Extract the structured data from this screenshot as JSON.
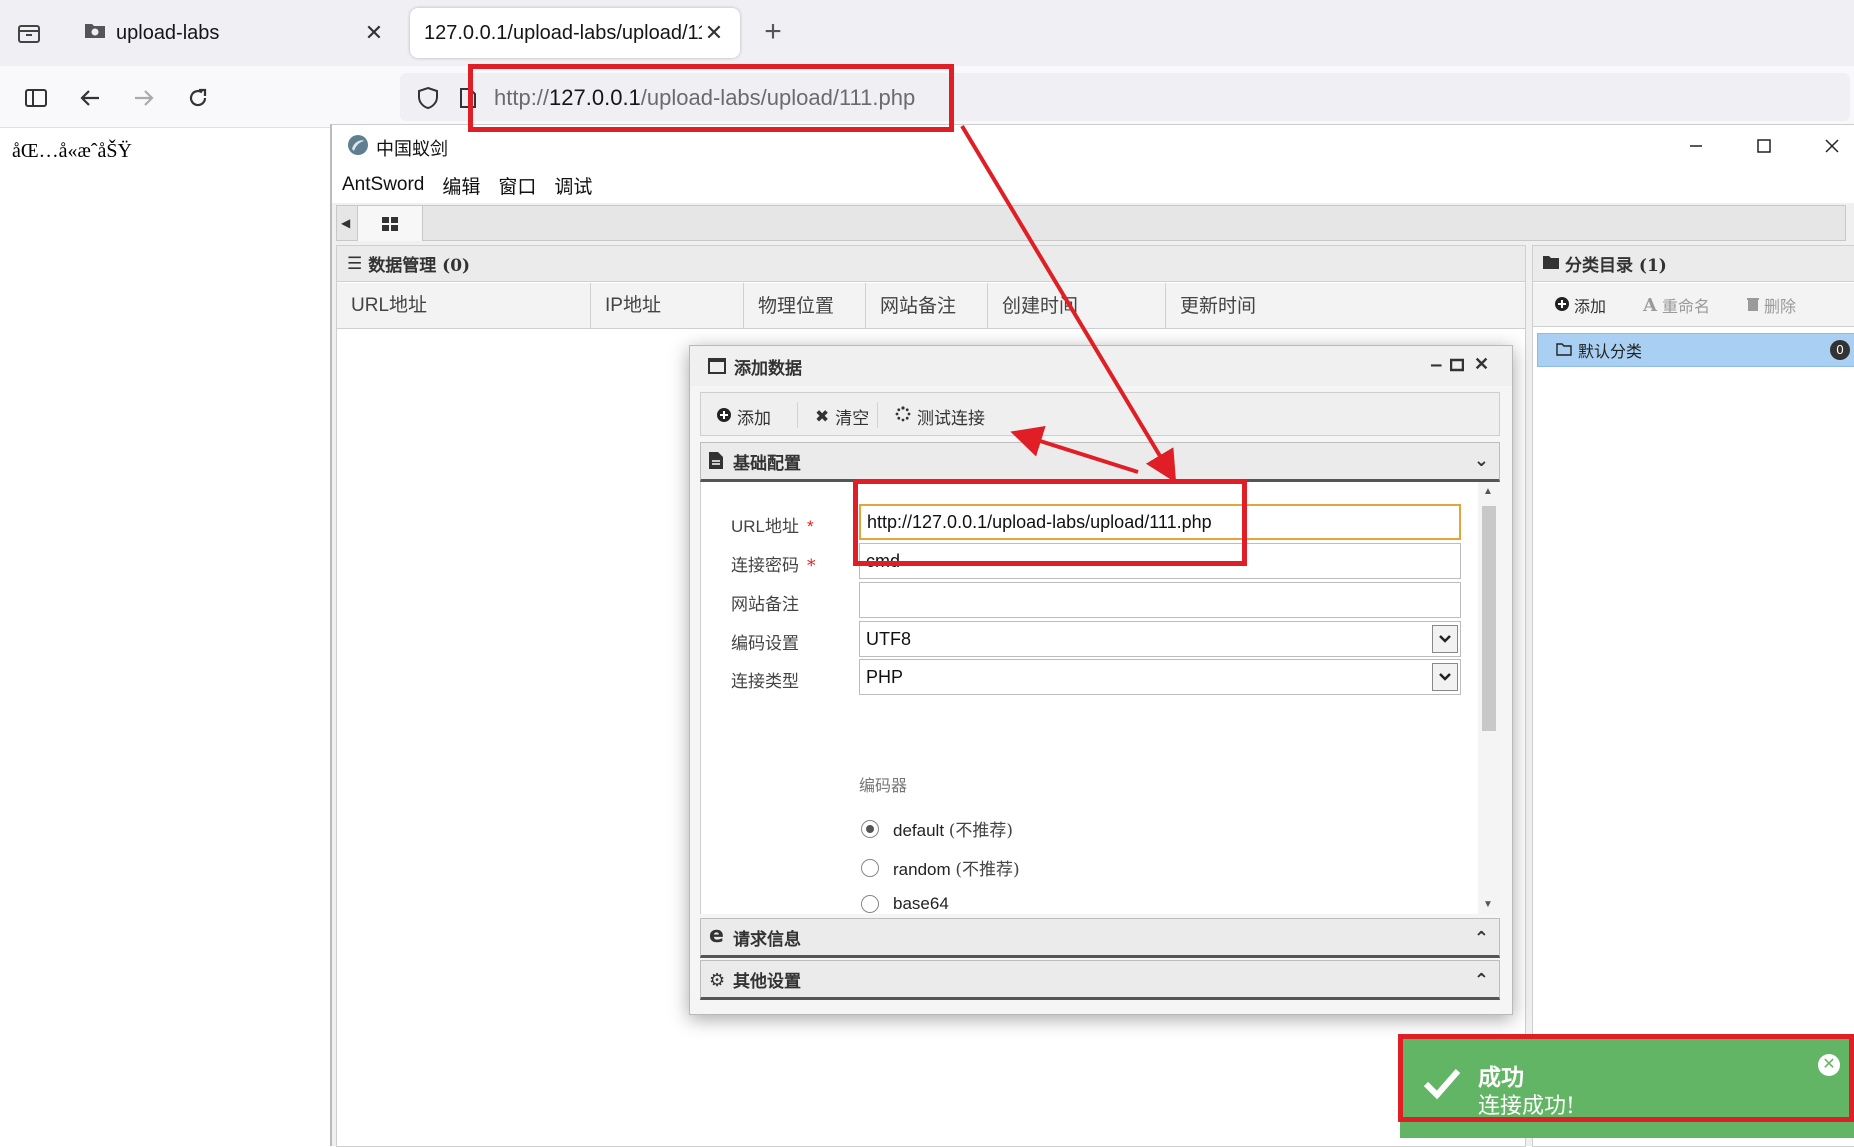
{
  "browser": {
    "tabs": [
      {
        "label": "upload-labs",
        "close": "✕"
      },
      {
        "label": "127.0.0.1/upload-labs/upload/11",
        "close": "✕"
      }
    ],
    "new_tab": "+",
    "url": {
      "prefix": "http://",
      "host": "127.0.0.1",
      "path": "/upload-labs/upload/111.php"
    }
  },
  "page": {
    "garbled_text": "åŒ…å«æˆåŠŸ"
  },
  "antsword": {
    "title": "中国蚁剑",
    "menu": [
      "AntSword",
      "编辑",
      "窗口",
      "调试"
    ],
    "data_panel": {
      "header": "数据管理 (0)",
      "columns": [
        "URL地址",
        "IP地址",
        "物理位置",
        "网站备注",
        "创建时间",
        "更新时间"
      ]
    },
    "category_panel": {
      "header": "分类目录 (1)",
      "buttons": {
        "add": "添加",
        "rename": "重命名",
        "delete": "删除"
      },
      "items": [
        {
          "label": "默认分类",
          "count": "0"
        }
      ]
    }
  },
  "dialog": {
    "title": "添加数据",
    "toolbar": {
      "add": "添加",
      "clear": "清空",
      "test": "测试连接"
    },
    "sections": {
      "basic": "基础配置",
      "request": "请求信息",
      "other": "其他设置"
    },
    "form": {
      "url_label": "URL地址",
      "url_value": "http://127.0.0.1/upload-labs/upload/111.php",
      "password_label": "连接密码",
      "password_value": "cmd",
      "note_label": "网站备注",
      "note_value": "",
      "encoding_label": "编码设置",
      "encoding_value": "UTF8",
      "type_label": "连接类型",
      "type_value": "PHP",
      "encoder_label": "编码器",
      "required_mark": "*",
      "encoders": [
        {
          "name": "default",
          "note": "(不推荐)",
          "selected": true
        },
        {
          "name": "random",
          "note": "(不推荐)",
          "selected": false
        },
        {
          "name": "base64",
          "note": "",
          "selected": false
        }
      ]
    }
  },
  "toast": {
    "title": "成功",
    "message": "连接成功!",
    "close": "✕"
  },
  "colors": {
    "annotation": "#e01e25",
    "toast_bg": "#62b565",
    "selected_item": "#a9cff2",
    "focus_border": "#e5a43a"
  },
  "icons": [
    "tab-list-icon",
    "folder-icon",
    "sidebar-icon",
    "back-arrow-icon",
    "forward-arrow-icon",
    "reload-icon",
    "shield-icon",
    "page-icon",
    "antsword-logo",
    "minimize-icon",
    "maximize-icon",
    "close-icon",
    "grid-icon",
    "list-icon",
    "folder-icon",
    "plus-circle-icon",
    "font-icon",
    "trash-icon",
    "window-icon",
    "times-icon",
    "spinner-icon",
    "file-icon",
    "edge-icon",
    "gears-icon",
    "chevron-down-icon",
    "chevron-up-icon",
    "check-icon"
  ]
}
